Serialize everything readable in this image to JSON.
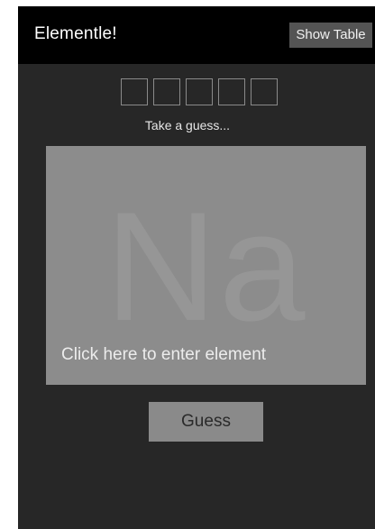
{
  "header": {
    "title": "Elementle!",
    "show_table_label": "Show Table"
  },
  "guess_slots": [
    "",
    "",
    "",
    "",
    ""
  ],
  "prompt": "Take a guess...",
  "element_panel": {
    "symbol": "Na",
    "hint": "Click here to enter element"
  },
  "guess_button_label": "Guess",
  "colors": {
    "background": "#272727",
    "topbar": "#000000",
    "panel": "#8c8c8c",
    "button": "#8a8a8a"
  }
}
